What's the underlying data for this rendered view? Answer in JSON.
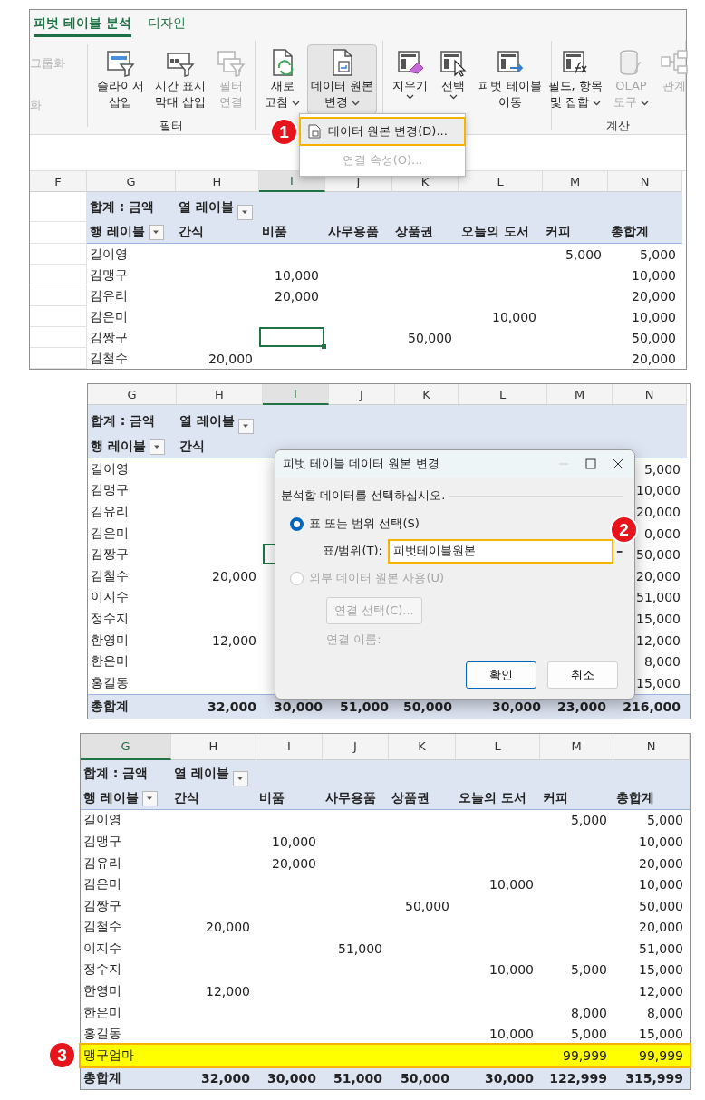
{
  "step1": {
    "badge": "1",
    "tabs": [
      {
        "label": "피벗 테이블 분석",
        "selected": true
      },
      {
        "label": "디자인",
        "selected": false
      }
    ],
    "edge_items": [
      "그룹화",
      "화"
    ],
    "groups": [
      {
        "label": "필터",
        "buttons": [
          {
            "lines": [
              "슬라이서",
              "삽입"
            ],
            "dropdown": false,
            "disabled": false,
            "selected": false
          },
          {
            "lines": [
              "시간 표시",
              "막대 삽입"
            ],
            "dropdown": false,
            "disabled": false,
            "selected": false
          },
          {
            "lines": [
              "필터",
              "연결"
            ],
            "dropdown": false,
            "disabled": true,
            "selected": false
          }
        ]
      },
      {
        "buttons": [
          {
            "lines": [
              "새로",
              "고침"
            ],
            "dropdown": true,
            "disabled": false,
            "selected": false
          },
          {
            "lines": [
              "데이터 원본",
              "변경"
            ],
            "dropdown": true,
            "disabled": false,
            "selected": true
          }
        ]
      },
      {
        "buttons": [
          {
            "lines": [
              "지우기"
            ],
            "dropdown": true,
            "disabled": false,
            "selected": false
          },
          {
            "lines": [
              "선택"
            ],
            "dropdown": true,
            "disabled": false,
            "selected": false
          },
          {
            "lines": [
              "피벗 테이블",
              "이동"
            ],
            "dropdown": false,
            "disabled": false,
            "selected": false
          }
        ]
      },
      {
        "label": "계산",
        "buttons": [
          {
            "lines": [
              "필드, 항목",
              "및 집합"
            ],
            "dropdown": true,
            "disabled": false,
            "selected": false
          },
          {
            "lines": [
              "OLAP",
              "도구"
            ],
            "dropdown": true,
            "disabled": true,
            "selected": false
          },
          {
            "lines": [
              "관계"
            ],
            "dropdown": false,
            "disabled": true,
            "selected": false
          }
        ]
      }
    ],
    "menu": [
      {
        "label": "데이터 원본 변경(D)...",
        "highlighted": true,
        "disabled": false
      },
      {
        "label": "연결 속성(O)...",
        "highlighted": false,
        "disabled": true
      }
    ],
    "sheet": {
      "columns": [
        {
          "label": "F",
          "selected": false
        },
        {
          "label": "G",
          "selected": false
        },
        {
          "label": "H",
          "selected": false
        },
        {
          "label": "I",
          "selected": true
        },
        {
          "label": "J",
          "selected": false
        },
        {
          "label": "K",
          "selected": false
        },
        {
          "label": "L",
          "selected": false
        },
        {
          "label": "M",
          "selected": false
        },
        {
          "label": "N",
          "selected": false
        }
      ],
      "sum_label": "합계 : 금액",
      "col_label": "열 레이블",
      "row_label": "행 레이블",
      "headers": {
        "H": "간식",
        "I": "비품",
        "J": "사무용품",
        "K": "상품권",
        "L": "오늘의 도서",
        "M": "커피",
        "N": "총합계"
      },
      "rows": [
        {
          "name": "길이영",
          "M": "5,000",
          "N": "5,000"
        },
        {
          "name": "김맹구",
          "I": "10,000",
          "N": "10,000"
        },
        {
          "name": "김유리",
          "I": "20,000",
          "N": "20,000"
        },
        {
          "name": "김은미",
          "L": "10,000",
          "N": "10,000"
        },
        {
          "name": "김짱구",
          "I": {
            "active": true
          },
          "K": "50,000",
          "N": "50,000"
        },
        {
          "name": "김철수",
          "H": "20,000",
          "N": "20,000"
        }
      ]
    }
  },
  "step2": {
    "badge": "2",
    "sheet": {
      "columns": [
        {
          "label": "G",
          "selected": false
        },
        {
          "label": "H",
          "selected": false
        },
        {
          "label": "I",
          "selected": true
        },
        {
          "label": "J",
          "selected": false
        },
        {
          "label": "K",
          "selected": false
        },
        {
          "label": "L",
          "selected": false
        },
        {
          "label": "M",
          "selected": false
        },
        {
          "label": "N",
          "selected": false
        }
      ],
      "sum_label": "합계 : 금액",
      "col_label": "열 레이블",
      "row_label": "행 레이블",
      "headers": {
        "H": "간식"
      },
      "rows": [
        {
          "name": "길이영",
          "N": "5,000"
        },
        {
          "name": "김맹구",
          "N": "10,000"
        },
        {
          "name": "김유리",
          "N": "20,000"
        },
        {
          "name": "김은미",
          "N": "0,000"
        },
        {
          "name": "김짱구",
          "I": {
            "active": true
          },
          "N": "50,000"
        },
        {
          "name": "김철수",
          "H": "20,000",
          "N": "20,000"
        },
        {
          "name": "이지수",
          "N": "51,000"
        },
        {
          "name": "정수지",
          "N": "15,000"
        },
        {
          "name": "한영미",
          "H": "12,000",
          "N": "12,000"
        },
        {
          "name": "한은미",
          "N": "8,000"
        },
        {
          "name": "홍길동",
          "N": "15,000"
        }
      ],
      "total": {
        "name": "총합계",
        "H": "32,000",
        "I": "30,000",
        "J": "51,000",
        "K": "50,000",
        "L": "30,000",
        "M": "23,000",
        "N": "216,000"
      }
    },
    "dialog": {
      "title": "피벗 테이블 데이터 원본 변경",
      "prompt": "분석할 데이터를 선택하십시오.",
      "options": [
        {
          "label": "표 또는 범위 선택(S)",
          "selected": true,
          "disabled": false
        },
        {
          "label": "외부 데이터 원본 사용(U)",
          "selected": false,
          "disabled": true
        }
      ],
      "range_label": "표/범위(T):",
      "range_value": "피벗테이블원본",
      "range_highlighted": true,
      "connection_button": "연결 선택(C)...",
      "connection_name_label": "연결 이름:",
      "buttons": [
        {
          "label": "확인",
          "default": true
        },
        {
          "label": "취소",
          "default": false
        }
      ]
    }
  },
  "step3": {
    "badge": "3",
    "sheet": {
      "columns": [
        {
          "label": "G",
          "selected": true
        },
        {
          "label": "H",
          "selected": false
        },
        {
          "label": "I",
          "selected": false
        },
        {
          "label": "J",
          "selected": false
        },
        {
          "label": "K",
          "selected": false
        },
        {
          "label": "L",
          "selected": false
        },
        {
          "label": "M",
          "selected": false
        },
        {
          "label": "N",
          "selected": false
        }
      ],
      "sum_label": "합계 : 금액",
      "col_label": "열 레이블",
      "row_label": "행 레이블",
      "headers": {
        "H": "간식",
        "I": "비품",
        "J": "사무용품",
        "K": "상품권",
        "L": "오늘의 도서",
        "M": "커피",
        "N": "총합계"
      },
      "rows": [
        {
          "name": "길이영",
          "highlighted": false,
          "M": "5,000",
          "N": "5,000"
        },
        {
          "name": "김맹구",
          "highlighted": false,
          "I": "10,000",
          "N": "10,000"
        },
        {
          "name": "김유리",
          "highlighted": false,
          "I": "20,000",
          "N": "20,000"
        },
        {
          "name": "김은미",
          "highlighted": false,
          "L": "10,000",
          "N": "10,000"
        },
        {
          "name": "김짱구",
          "highlighted": false,
          "K": "50,000",
          "N": "50,000"
        },
        {
          "name": "김철수",
          "highlighted": false,
          "H": "20,000",
          "N": "20,000"
        },
        {
          "name": "이지수",
          "highlighted": false,
          "J": "51,000",
          "N": "51,000"
        },
        {
          "name": "정수지",
          "highlighted": false,
          "L": "10,000",
          "M": "5,000",
          "N": "15,000"
        },
        {
          "name": "한영미",
          "highlighted": false,
          "H": "12,000",
          "N": "12,000"
        },
        {
          "name": "한은미",
          "highlighted": false,
          "M": "8,000",
          "N": "8,000"
        },
        {
          "name": "홍길동",
          "highlighted": false,
          "L": "10,000",
          "M": "5,000",
          "N": "15,000"
        },
        {
          "name": "맹구엄마",
          "highlighted": true,
          "M": "99,999",
          "N": "99,999"
        }
      ],
      "total": {
        "name": "총합계",
        "H": "32,000",
        "I": "30,000",
        "J": "51,000",
        "K": "50,000",
        "L": "30,000",
        "M": "122,999",
        "N": "315,999"
      }
    }
  }
}
